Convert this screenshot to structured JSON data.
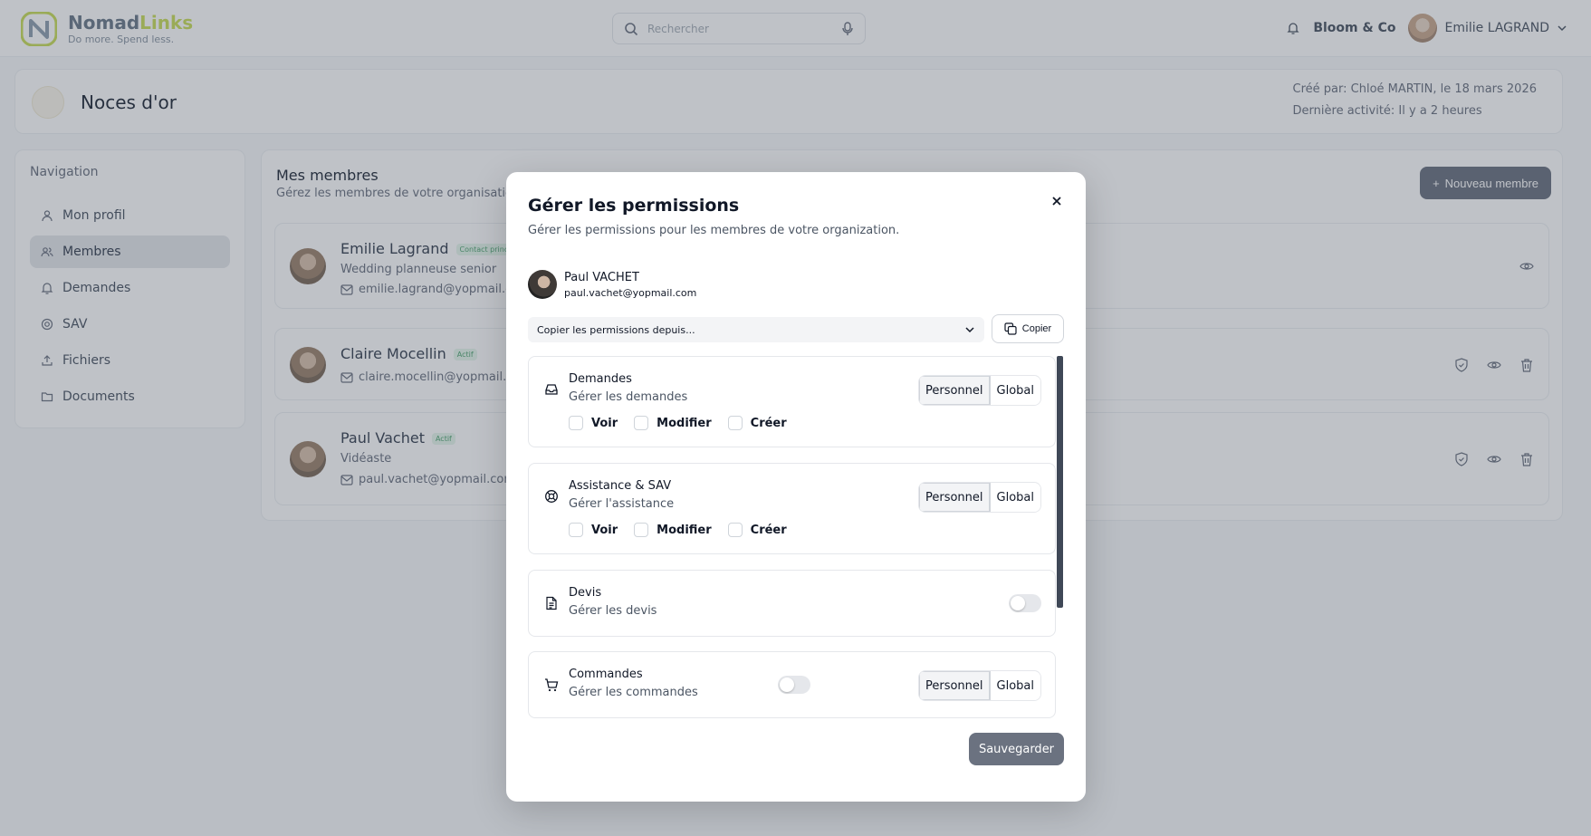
{
  "app": {
    "brand_first": "Nomad",
    "brand_second": "Links",
    "tagline": "Do more. Spend less.",
    "search_placeholder": "Rechercher",
    "organization": "Bloom & Co",
    "user_name": "Emilie LAGRAND"
  },
  "project": {
    "title": "Noces d'or",
    "created": "Créé par: Chloé MARTIN, le 18 mars 2026",
    "last_activity": "Dernière activité: Il y a 2 heures"
  },
  "sidebar": {
    "title": "Navigation",
    "items": [
      {
        "label": "Mon profil",
        "icon": "user-icon"
      },
      {
        "label": "Membres",
        "icon": "users-icon",
        "active": true
      },
      {
        "label": "Demandes",
        "icon": "bell-icon"
      },
      {
        "label": "SAV",
        "icon": "lifebuoy-icon"
      },
      {
        "label": "Fichiers",
        "icon": "upload-icon"
      },
      {
        "label": "Documents",
        "icon": "folder-icon"
      }
    ]
  },
  "members": {
    "title": "Mes membres",
    "subtitle": "Gérez les membres de votre organisation",
    "new_button": "Nouveau membre",
    "list": [
      {
        "name": "Emilie Lagrand",
        "badge": "Contact principal",
        "role": "Wedding planneuse senior",
        "email": "emilie.lagrand@yopmail.com"
      },
      {
        "name": "Claire Mocellin",
        "badge": "Actif",
        "role": "",
        "email": "claire.mocellin@yopmail.com"
      },
      {
        "name": "Paul Vachet",
        "badge": "Actif",
        "role": "Vidéaste",
        "email": "paul.vachet@yopmail.com"
      }
    ]
  },
  "modal": {
    "title": "Gérer les permissions",
    "subtitle": "Gérer les permissions pour les membres de votre organization.",
    "user_name": "Paul VACHET",
    "user_email": "paul.vachet@yopmail.com",
    "copy_placeholder": "Copier les permissions depuis...",
    "copy_button": "Copier",
    "save_button": "Sauvegarder",
    "scope_personal": "Personnel",
    "scope_global": "Global",
    "perm_view": "Voir",
    "perm_edit": "Modifier",
    "perm_create": "Créer",
    "permissions": [
      {
        "title": "Demandes",
        "description": "Gérer les demandes",
        "icon": "inbox-icon"
      },
      {
        "title": "Assistance & SAV",
        "description": "Gérer l'assistance",
        "icon": "lifebuoy-icon"
      },
      {
        "title": "Devis",
        "description": "Gérer les devis",
        "icon": "document-icon",
        "enabled": false
      },
      {
        "title": "Commandes",
        "description": "Gérer les commandes",
        "icon": "cart-icon",
        "enabled": false
      }
    ]
  }
}
